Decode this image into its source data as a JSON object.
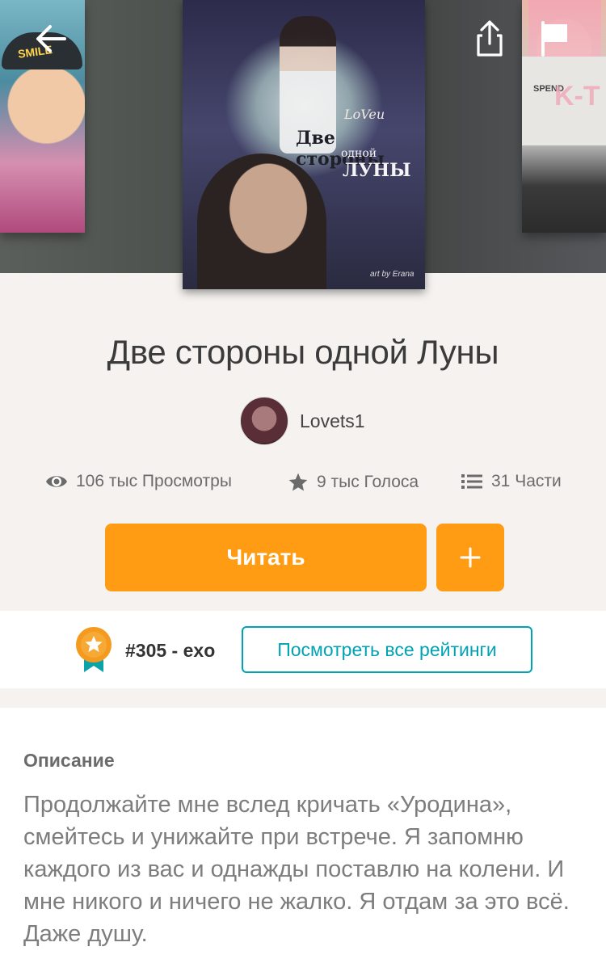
{
  "hero": {
    "cover_main": {
      "line1": "LoVeu",
      "line2": "Две стороны",
      "line3": "одной",
      "line4": "ЛУНЫ",
      "credit": "art by Erana"
    },
    "cover_left": {
      "cap_text": "SMILE"
    },
    "cover_right": {
      "shirt_text": "SPEND",
      "big_text": "K-T"
    },
    "back_icon": "arrow-left",
    "share_icon": "share",
    "flag_icon": "flag"
  },
  "story": {
    "title": "Две стороны одной Луны",
    "author": "Lovets1",
    "stats": {
      "views": "106 тыс Просмотры",
      "votes": "9 тыс Голоса",
      "parts": "31 Части"
    }
  },
  "actions": {
    "read_label": "Читать",
    "add_label": "+"
  },
  "ranking": {
    "rank_text": "#305 - exo",
    "view_all_label": "Посмотреть все рейтинги"
  },
  "description": {
    "heading": "Описание",
    "text": "Продолжайте мне вслед кричать «Уродина», смейтесь и унижайте при встрече. Я запомню каждого из вас и однажды поставлю на колени. И мне никого и ничего не жалко. Я отдам за это всё. Даже душу."
  },
  "colors": {
    "accent": "#ff9c14",
    "link": "#00a3b4",
    "background": "#f5f2ef"
  }
}
